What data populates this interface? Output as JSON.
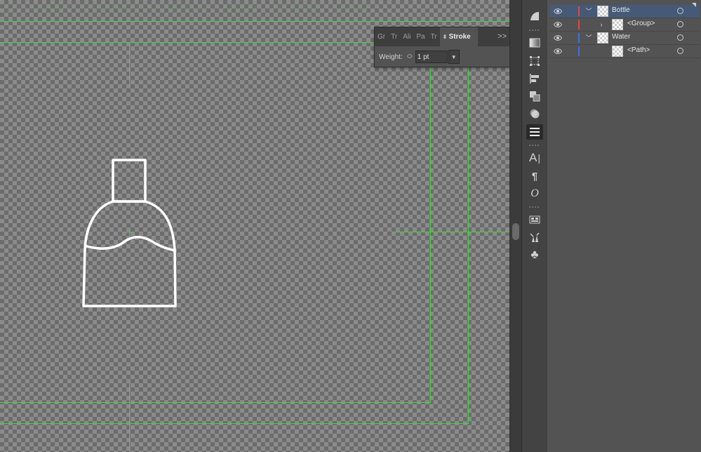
{
  "stroke_panel": {
    "tabs": [
      {
        "label": "Gr",
        "active": false
      },
      {
        "label": "Tr",
        "active": false
      },
      {
        "label": "Ali",
        "active": false
      },
      {
        "label": "Pa",
        "active": false
      },
      {
        "label": "Tr",
        "active": false
      },
      {
        "label": "Stroke",
        "active": true
      }
    ],
    "weight_label": "Weight:",
    "weight_value": "1 pt"
  },
  "layers": {
    "rows": [
      {
        "name": "Bottle",
        "type": "layer",
        "expanded": true,
        "selected": true,
        "color": "#e0464a"
      },
      {
        "name": "<Group>",
        "type": "group",
        "expanded": false,
        "selected": false,
        "color": "#e0464a"
      },
      {
        "name": "Water",
        "type": "layer",
        "expanded": true,
        "selected": false,
        "color": "#3f6fe0"
      },
      {
        "name": "<Path>",
        "type": "path",
        "expanded": false,
        "selected": false,
        "color": "#3f6fe0"
      }
    ]
  },
  "tools": [
    "gradient-shape-icon",
    "gradient-icon",
    "transform-icon",
    "align-icon",
    "pathfinder-icon",
    "appearance-icon",
    "stroke-icon",
    "character-icon",
    "paragraph-icon",
    "opentype-icon",
    "libraries-icon",
    "brushes-icon",
    "symbols-icon"
  ],
  "colors": {
    "guide": "#3fd23f",
    "canvas_dark": "#6c6c6c",
    "canvas_light": "#8b8b8b",
    "selection": "#465a77",
    "artwork_stroke": "#ffffff"
  }
}
